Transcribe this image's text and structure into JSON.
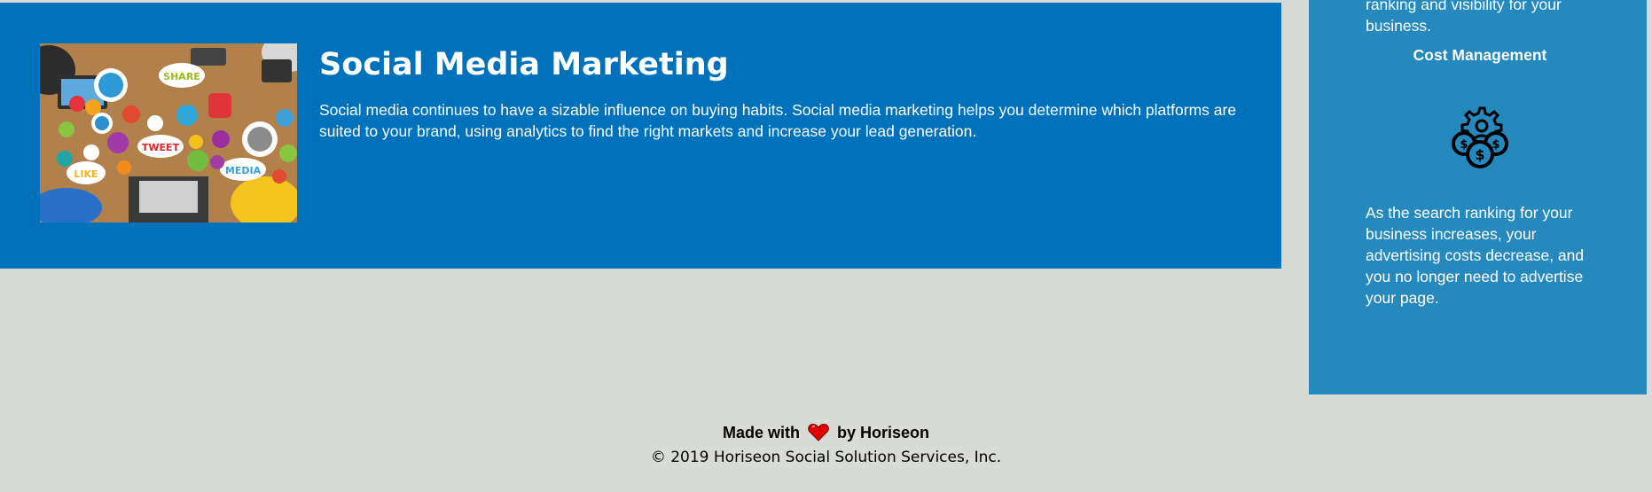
{
  "social_media": {
    "title": "Social Media Marketing",
    "description": "Social media continues to have a sizable influence on buying habits. Social media marketing helps you determine which platforms are suited to your brand, using analytics to find the right markets and increase your lead generation.",
    "image_labels": [
      "SHARE",
      "TWEET",
      "LIKE",
      "MEDIA"
    ]
  },
  "cost_management": {
    "previous_text": "ranking and visibility for your business.",
    "title": "Cost Management",
    "icon": "cost-management-icon",
    "description": "As the search ranking for your business increases, your advertising costs decrease, and you no longer need to advertise your page."
  },
  "footer": {
    "made_with": "Made with",
    "by": "by Horiseon",
    "copyright": "© 2019 Horiseon Social Solution Services, Inc."
  },
  "colors": {
    "page_background": "#d9dcd6",
    "card_primary": "#0072bb",
    "card_secondary": "#2589bd",
    "heart": "#e00000"
  }
}
